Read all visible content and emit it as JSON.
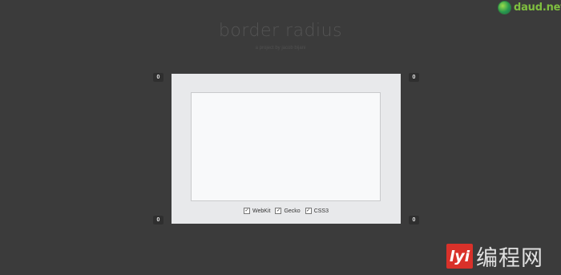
{
  "brand": {
    "logo_text": "daud.net",
    "logo_icon": "globe-logo-icon"
  },
  "header": {
    "title": "border radius",
    "subtitle": "a project by jacob bijani"
  },
  "corners": {
    "top_left": "0",
    "top_right": "0",
    "bottom_left": "0",
    "bottom_right": "0"
  },
  "options": [
    {
      "label": "WebKit",
      "checked": true
    },
    {
      "label": "Gecko",
      "checked": true
    },
    {
      "label": "CSS3",
      "checked": true
    }
  ],
  "watermark": {
    "badge": "lyi",
    "text": "编程网"
  }
}
